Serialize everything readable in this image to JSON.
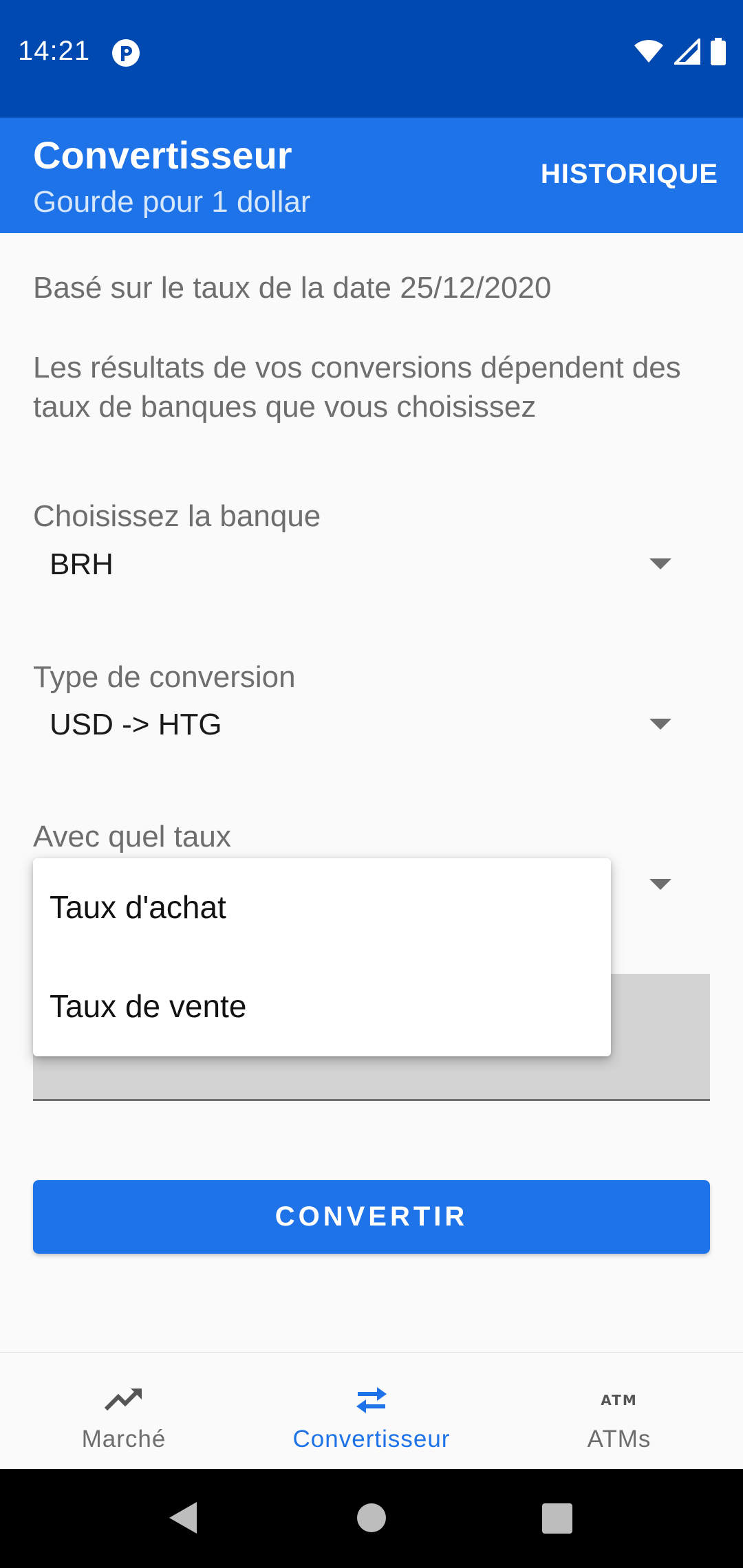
{
  "status_bar": {
    "time": "14:21",
    "icons": [
      "app-notification-icon",
      "wifi-icon",
      "signal-icon",
      "battery-icon"
    ]
  },
  "app_bar": {
    "title": "Convertisseur",
    "subtitle": "Gourde pour 1 dollar",
    "history_label": "HISTORIQUE"
  },
  "info": {
    "date_text": "Basé sur le taux de la date 25/12/2020",
    "note_text": "Les résultats de vos conversions dépendent des taux de banques que vous choisissez"
  },
  "fields": {
    "bank": {
      "label": "Choisissez la banque",
      "value": "BRH"
    },
    "conversion_type": {
      "label": "Type de conversion",
      "value": "USD -> HTG"
    },
    "rate": {
      "label": "Avec quel taux",
      "value": ""
    }
  },
  "rate_popup": {
    "options": [
      "Taux d'achat",
      "Taux de vente"
    ]
  },
  "convert_button": {
    "label": "CONVERTIR"
  },
  "bottom_nav": {
    "items": [
      {
        "label": "Marché",
        "icon": "trending-up-icon",
        "active": false
      },
      {
        "label": "Convertisseur",
        "icon": "swap-arrows-icon",
        "active": true
      },
      {
        "label": "ATMs",
        "icon": "atm-icon",
        "active": false
      }
    ]
  },
  "colors": {
    "status_bar": "#0049b0",
    "primary": "#1e73e8",
    "text_secondary": "#6e6e6e",
    "background": "#fafafa"
  }
}
